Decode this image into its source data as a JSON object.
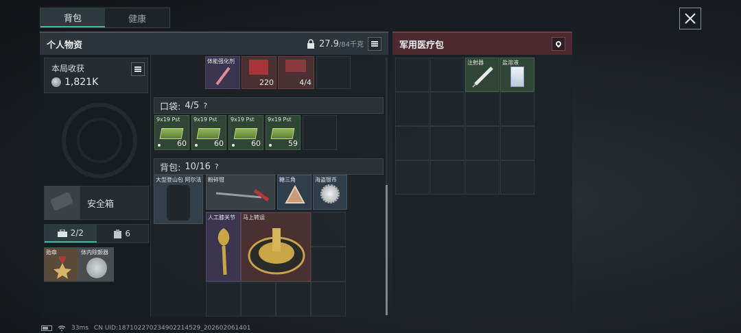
{
  "tabs": {
    "backpack": "背包",
    "health": "健康"
  },
  "left": {
    "title": "个人物资",
    "weight": "27.9",
    "weight_max": "/84千克",
    "harvest_label": "本局收获",
    "harvest_value": "1,821K",
    "safebox": "安全箱",
    "sub_tab1": "2/2",
    "sub_tab2": "6",
    "sub_items": [
      {
        "label": "勋章"
      },
      {
        "label": "体内除颤器"
      }
    ],
    "top_items": [
      {
        "label": "体能强化剂"
      },
      {
        "label": "",
        "count": "220"
      },
      {
        "label": "",
        "count": "4/4"
      }
    ],
    "pocket_label": "口袋:",
    "pocket_count": "4/5",
    "pocket_items": [
      {
        "label": "9x19 Pst",
        "count": "60"
      },
      {
        "label": "9x19 Pst",
        "count": "60"
      },
      {
        "label": "9x19 Pst",
        "count": "60"
      },
      {
        "label": "9x19 Pst",
        "count": "59"
      }
    ],
    "bag_label": "背包:",
    "bag_count": "10/16",
    "bag_items": [
      {
        "label": "大型登山包 阿尔法"
      },
      {
        "label": "粉碎钳"
      },
      {
        "label": "糖三角"
      },
      {
        "label": "海盗银币"
      },
      {
        "label": "人工膝关节"
      },
      {
        "label": "马上转运"
      }
    ],
    "help": "?"
  },
  "right": {
    "title": "军用医疗包",
    "items": [
      {
        "label": "注射器"
      },
      {
        "label": "盐溶液"
      }
    ]
  },
  "status": {
    "ping": "33ms",
    "uid": "CN UID:18710227023490221452​9_202602061401"
  }
}
